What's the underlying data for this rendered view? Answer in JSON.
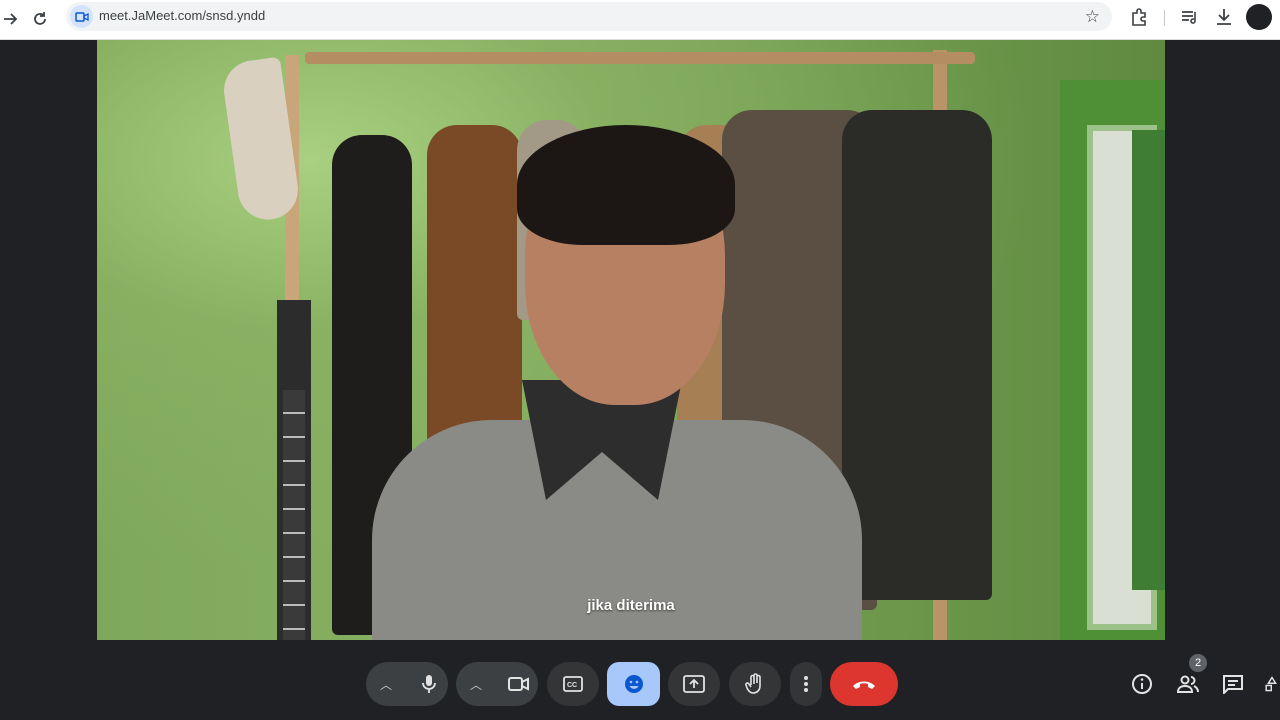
{
  "browser": {
    "url": "meet.JaMeet.com/snsd.yndd",
    "icons": [
      "forward-icon",
      "reload-icon",
      "site-camera-icon",
      "bookmark-star-icon",
      "extensions-icon",
      "media-queue-icon",
      "download-icon",
      "profile-avatar"
    ]
  },
  "meeting": {
    "caption": "jika diterima",
    "participants_count": "2"
  },
  "controls": {
    "items": [
      "mic-options-chevron",
      "microphone",
      "camera-options-chevron",
      "camera",
      "captions",
      "reactions",
      "present-screen",
      "raise-hand",
      "more-options",
      "leave-call"
    ],
    "right": [
      "meeting-info",
      "people",
      "chat",
      "activities"
    ]
  },
  "colors": {
    "call_bar_bg": "#202124",
    "leave_red": "#dc362e",
    "reactions_active": "#a8c7fa"
  }
}
